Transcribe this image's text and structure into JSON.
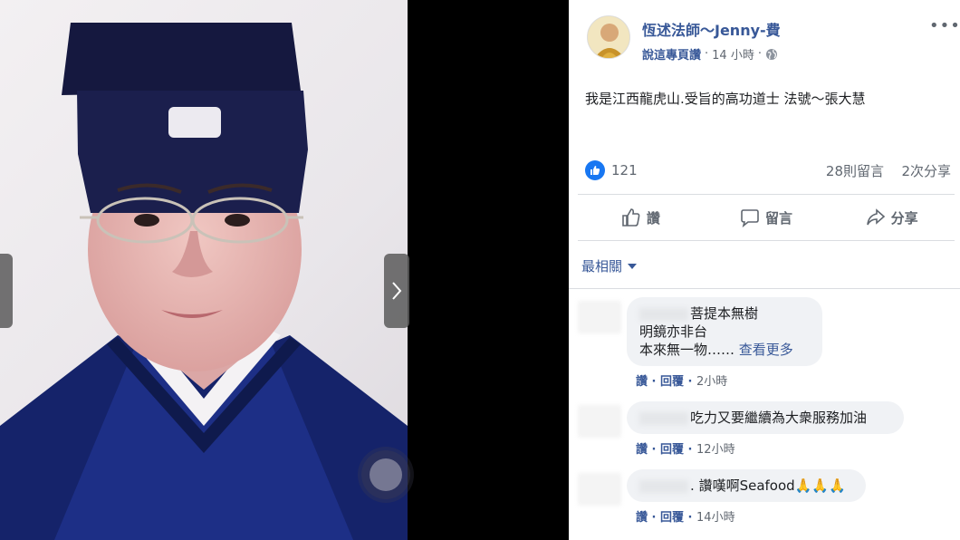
{
  "post": {
    "author": "恆述法師～Jenny-費",
    "like_page": "說這專頁讚",
    "time": "14 小時",
    "separator": "·",
    "text": "我是江西龍虎山.受旨的高功道士 法號～張大慧",
    "likes": "121",
    "comments": "28則留言",
    "shares": "2次分享"
  },
  "actions": {
    "like": "讚",
    "comment": "留言",
    "share": "分享"
  },
  "sort": {
    "label": "最相關"
  },
  "comments": [
    {
      "line1": "菩提本無樹",
      "line2": "明鏡亦非台",
      "line3": "本來無一物……",
      "see_more": "查看更多",
      "like": "讚",
      "reply": "回覆",
      "time": "2小時"
    },
    {
      "text": "吃力又要繼續為大衆服務加油",
      "like": "讚",
      "reply": "回覆",
      "time": "12小時"
    },
    {
      "prefix": ".",
      "text": "讚嘆啊Seafood",
      "pray": "🙏🙏🙏",
      "like": "讚",
      "reply": "回覆",
      "time": "14小時"
    }
  ],
  "icons": [
    "chevron-right-icon",
    "more-icon",
    "globe-icon",
    "thumbs-up-icon",
    "comment-icon",
    "share-icon",
    "caret-down-icon"
  ],
  "colors": {
    "brand_blue": "#1877f2",
    "link": "#385898",
    "muted": "#606770",
    "bubble": "#f0f2f5",
    "robe": "#1a2a6e"
  }
}
